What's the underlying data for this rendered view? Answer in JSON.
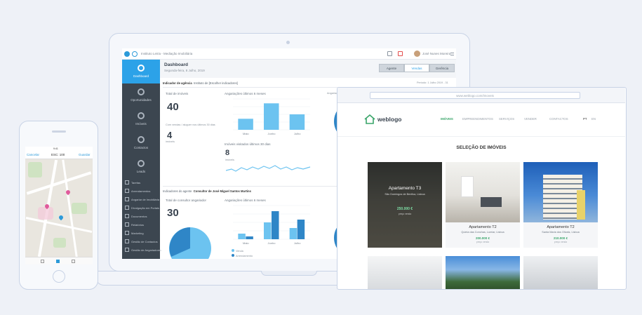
{
  "laptop": {
    "crumb": "Instituto Leiria - Mediação Imobiliária",
    "user": "José Nunes Moreira",
    "sidebar": [
      {
        "label": "Dashboard",
        "icon": "dashboard-icon"
      },
      {
        "label": "Oportunidades",
        "icon": "target-icon"
      },
      {
        "label": "Imóveis",
        "icon": "home-icon"
      },
      {
        "label": "Contactos",
        "icon": "user-icon"
      },
      {
        "label": "Leads",
        "icon": "inbox-icon"
      }
    ],
    "side_sub": [
      "Tarefas",
      "Arrendamentos",
      "Angariar de Imobiliária",
      "Divulgação em Portais",
      "Documentos",
      "Relatórios",
      "Marketing",
      "Gestão de Contactos",
      "Gestão de Angariadores"
    ],
    "header": {
      "title": "Dashboard",
      "date": "Segunda-feira, 8 Julho, 2019"
    },
    "tabs": [
      "Agente",
      "Vendas",
      "Gerência"
    ],
    "filter": {
      "label": "Indicador de agência",
      "value": "Instituto de [Escolher indicadores]"
    },
    "date_filter": "Período: 1 Julho 2019 - 31",
    "top": {
      "total_label": "Total de imóveis",
      "total": "40",
      "cards_label": "Com vendas / aluguer nos últimos 30 dias",
      "cards_value": "4",
      "cards_sub": "imóveis",
      "chart_title": "Angariações últimos 6 meses",
      "viewed_label": "Imóveis visitados últimos 30 dias",
      "viewed_value": "8",
      "viewed_sub": "imóveis"
    },
    "bottom": {
      "filter_label": "Indicadores do agente",
      "filter_value": "Consultor de José Miguel Santos Martins",
      "total_label": "Total de consultor angariador",
      "total": "30",
      "chart_title": "Angariações últimos 6 meses"
    },
    "bar_labels": [
      "Maio",
      "Junho",
      "Julho"
    ],
    "legend": [
      "Venda",
      "Arrendamento"
    ]
  },
  "phone": {
    "status": "9:41",
    "left": "Cancelar",
    "title": "ESC: 100",
    "right": "Guardar"
  },
  "browser": {
    "url": "www.weblogo.com/imoveis",
    "brand": "weblogo",
    "menu": [
      "IMÓVEIS",
      "EMPREENDIMENTOS",
      "SERVIÇOS",
      "VENDER",
      "CONTACTOS"
    ],
    "lang": [
      "PT",
      "EN"
    ],
    "section": "SELEÇÃO DE IMÓVEIS",
    "properties": [
      {
        "name": "Apartamento T3",
        "sub": "São Domingos de Benfica, Lisboa",
        "price": "250.000 €",
        "note": "preço venda"
      },
      {
        "name": "Apartamento T2",
        "sub": "Quinta das Conchas, Lumiar, Lisboa",
        "price": "200.000 €",
        "note": "preço venda"
      },
      {
        "name": "Apartamento T2",
        "sub": "Santa Maria dos Olivais, Lisboa",
        "price": "210.000 €",
        "note": "preço venda"
      }
    ]
  },
  "chart_data": [
    {
      "type": "bar",
      "title": "Angariações últimos 6 meses",
      "categories": [
        "Maio",
        "Junho",
        "Julho"
      ],
      "values": [
        5,
        12,
        7
      ],
      "ylim": [
        0,
        14
      ]
    },
    {
      "type": "bar",
      "title": "Angariações últimos 6 meses",
      "categories": [
        "Maio",
        "Junho",
        "Julho"
      ],
      "series": [
        {
          "name": "Venda",
          "values": [
            2,
            6,
            4
          ]
        },
        {
          "name": "Arrendamento",
          "values": [
            1,
            10,
            7
          ]
        }
      ],
      "ylim": [
        0,
        12
      ]
    }
  ],
  "colors": {
    "accent": "#2ca2e8",
    "sidebar": "#3c4650",
    "green": "#3aa56a",
    "bar_light": "#6cc3f0",
    "bar_dark": "#2f86c7"
  }
}
